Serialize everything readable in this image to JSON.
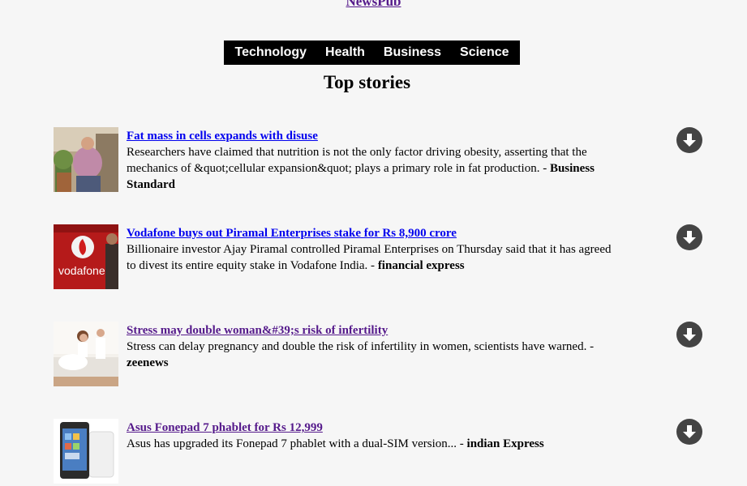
{
  "brand": "NewsPub",
  "nav": [
    "Technology",
    "Health",
    "Business",
    "Science"
  ],
  "section_title": "Top stories",
  "stories": [
    {
      "title": "Fat mass in cells expands with disuse ",
      "summary_line1": "Researchers have claimed that nutrition is not the only factor driving obesity, asserting that the",
      "summary_line2": "mechanics of &quot;cellular expansion&quot; plays a primary role in fat production. - ",
      "source": "Business Standard",
      "visited": false,
      "thumb_icon": "obese-person-photo"
    },
    {
      "title": "Vodafone buys out Piramal Enterprises stake for Rs 8,900 crore ",
      "summary_line1": "Billionaire investor Ajay Piramal controlled Piramal Enterprises on Thursday said that it has agreed",
      "summary_line2": "to divest its entire equity stake in Vodafone India. - ",
      "source": "financial express",
      "visited": false,
      "thumb_icon": "vodafone-logo-photo"
    },
    {
      "title": "Stress may double woman&#39;s risk of infertility ",
      "summary_line1": "Stress can delay pregnancy and double the risk of infertility in women, scientists have warned. -",
      "summary_line2": "",
      "source": "zeenews",
      "visited": true,
      "thumb_icon": "woman-bed-photo"
    },
    {
      "title": "Asus Fonepad 7 phablet for Rs 12,999 ",
      "summary_line1": "Asus has upgraded its Fonepad 7 phablet with a dual-SIM version... - ",
      "summary_line2": "",
      "source": "indian Express",
      "visited": true,
      "thumb_icon": "tablet-photo"
    }
  ],
  "download_icon": "download-arrow-icon",
  "colors": {
    "background": "#f6f6f6",
    "nav_bg": "#000000",
    "link": "#0000ee",
    "visited": "#551a8b",
    "download_button": "#444444"
  }
}
